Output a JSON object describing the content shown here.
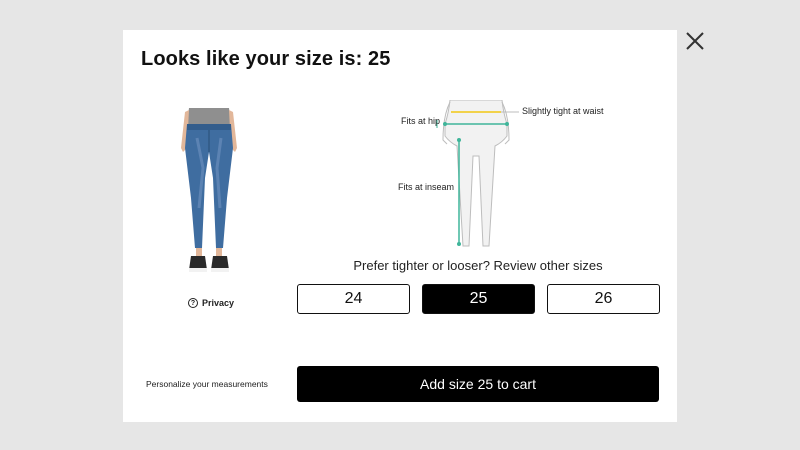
{
  "modal": {
    "title": "Looks like your size is: 25"
  },
  "privacy": {
    "icon": "question-circle-icon",
    "label": "Privacy"
  },
  "fit": {
    "labels": {
      "waist": "Slightly tight at waist",
      "hip": "Fits at hip",
      "inseam": "Fits at inseam"
    },
    "colors": {
      "waist": "#f2d24a",
      "hip": "#3fb59a",
      "inseam": "#3fb59a"
    }
  },
  "size_prompt": "Prefer tighter or looser? Review other sizes",
  "sizes": [
    {
      "label": "24",
      "selected": false
    },
    {
      "label": "25",
      "selected": true
    },
    {
      "label": "26",
      "selected": false
    }
  ],
  "personalize_label": "Personalize your measurements",
  "add_to_cart_label": "Add size 25 to cart",
  "close_icon": "close-icon"
}
